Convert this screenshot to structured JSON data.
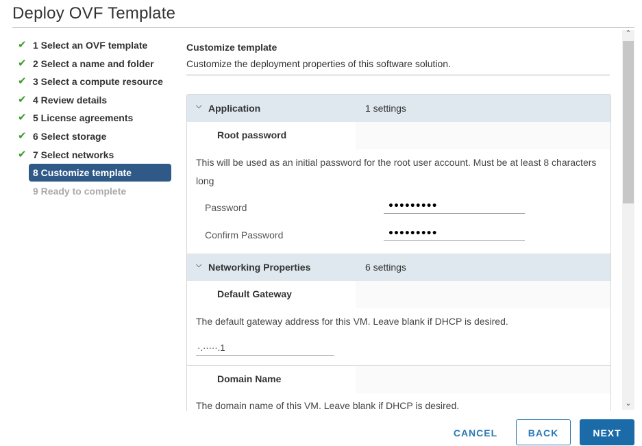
{
  "window": {
    "title": "Deploy OVF Template"
  },
  "steps": [
    {
      "label": "1 Select an OVF template",
      "state": "done"
    },
    {
      "label": "2 Select a name and folder",
      "state": "done"
    },
    {
      "label": "3 Select a compute resource",
      "state": "done"
    },
    {
      "label": "4 Review details",
      "state": "done"
    },
    {
      "label": "5 License agreements",
      "state": "done"
    },
    {
      "label": "6 Select storage",
      "state": "done"
    },
    {
      "label": "7 Select networks",
      "state": "done"
    },
    {
      "label": "8 Customize template",
      "state": "active"
    },
    {
      "label": "9 Ready to complete",
      "state": "disabled"
    }
  ],
  "check_glyph": "✔",
  "main": {
    "title": "Customize template",
    "subtitle": "Customize the deployment properties of this software solution."
  },
  "sections": {
    "application": {
      "name": "Application",
      "count": "1 settings",
      "chevron": "⌵",
      "root_password": {
        "title": "Root password",
        "description": "This will be used as an initial password for the root user account. Must be at least 8 characters long",
        "password_label": "Password",
        "password_value": "•••••••••",
        "confirm_label": "Confirm Password",
        "confirm_value": "•••••••••"
      }
    },
    "networking": {
      "name": "Networking Properties",
      "count": "6 settings",
      "chevron": "⌵",
      "default_gateway": {
        "title": "Default Gateway",
        "description": "The default gateway address for this VM. Leave blank if DHCP is desired.",
        "value": "·.·····.1"
      },
      "domain_name": {
        "title": "Domain Name",
        "description": "The domain name of this VM. Leave blank if DHCP is desired."
      }
    }
  },
  "scrollbar": {
    "up_glyph": "⌃",
    "down_glyph": "⌄"
  },
  "footer": {
    "cancel": "CANCEL",
    "back": "BACK",
    "next": "NEXT"
  },
  "colors": {
    "accent": "#2a79b5",
    "active_step": "#2f5a88",
    "check": "#3b9b2b",
    "section_header": "#dfe8ee"
  }
}
